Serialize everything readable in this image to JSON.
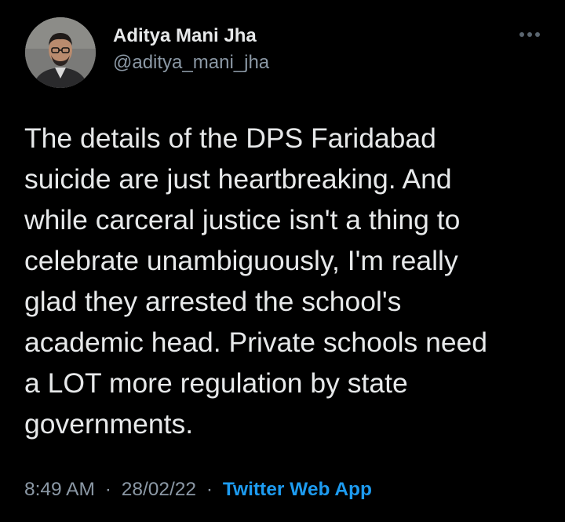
{
  "author": {
    "display_name": "Aditya Mani Jha",
    "handle": "@aditya_mani_jha",
    "avatar_icon": "user-photo-avatar"
  },
  "more_icon": "more-dots-icon",
  "tweet": {
    "lines": [
      "The details of the DPS Faridabad",
      "suicide are just heartbreaking. And",
      "while carceral justice isn't a thing to",
      "celebrate unambiguously, I'm really",
      "glad they arrested the school's",
      "academic head. Private schools need",
      "a LOT more regulation by state",
      "governments."
    ]
  },
  "meta": {
    "time": "8:49 AM",
    "separator": "·",
    "date": "28/02/22",
    "source": "Twitter Web App"
  },
  "colors": {
    "background": "#000000",
    "text": "#e7e9ea",
    "muted": "#8b98a5",
    "link": "#1d9bf0"
  }
}
